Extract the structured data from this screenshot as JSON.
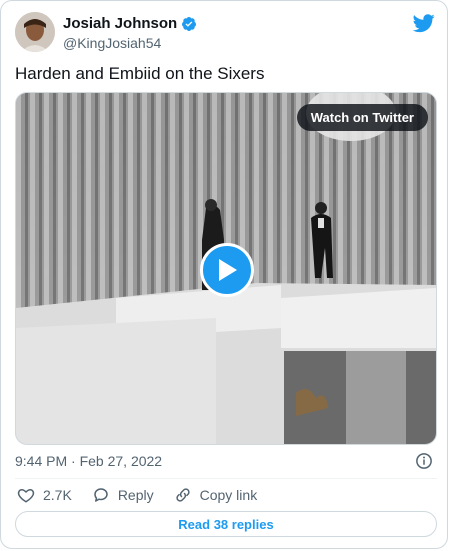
{
  "author": {
    "name": "Josiah Johnson",
    "handle": "@KingJosiah54",
    "verified": true
  },
  "tweet": {
    "text": "Harden and Embiid on the Sixers",
    "timestamp": "9:44 PM · Feb 27, 2022"
  },
  "media": {
    "watch_label": "Watch on Twitter"
  },
  "actions": {
    "likes": "2.7K",
    "reply_label": "Reply",
    "copy_label": "Copy link"
  },
  "read_replies_label": "Read 38 replies",
  "colors": {
    "accent": "#1d9bf0",
    "text": "#0f1419",
    "secondary": "#536471",
    "border": "#cfd9de"
  },
  "icons": [
    "twitter-bird-icon",
    "verified-badge-icon",
    "play-icon",
    "info-icon",
    "heart-icon",
    "reply-icon",
    "link-icon"
  ]
}
